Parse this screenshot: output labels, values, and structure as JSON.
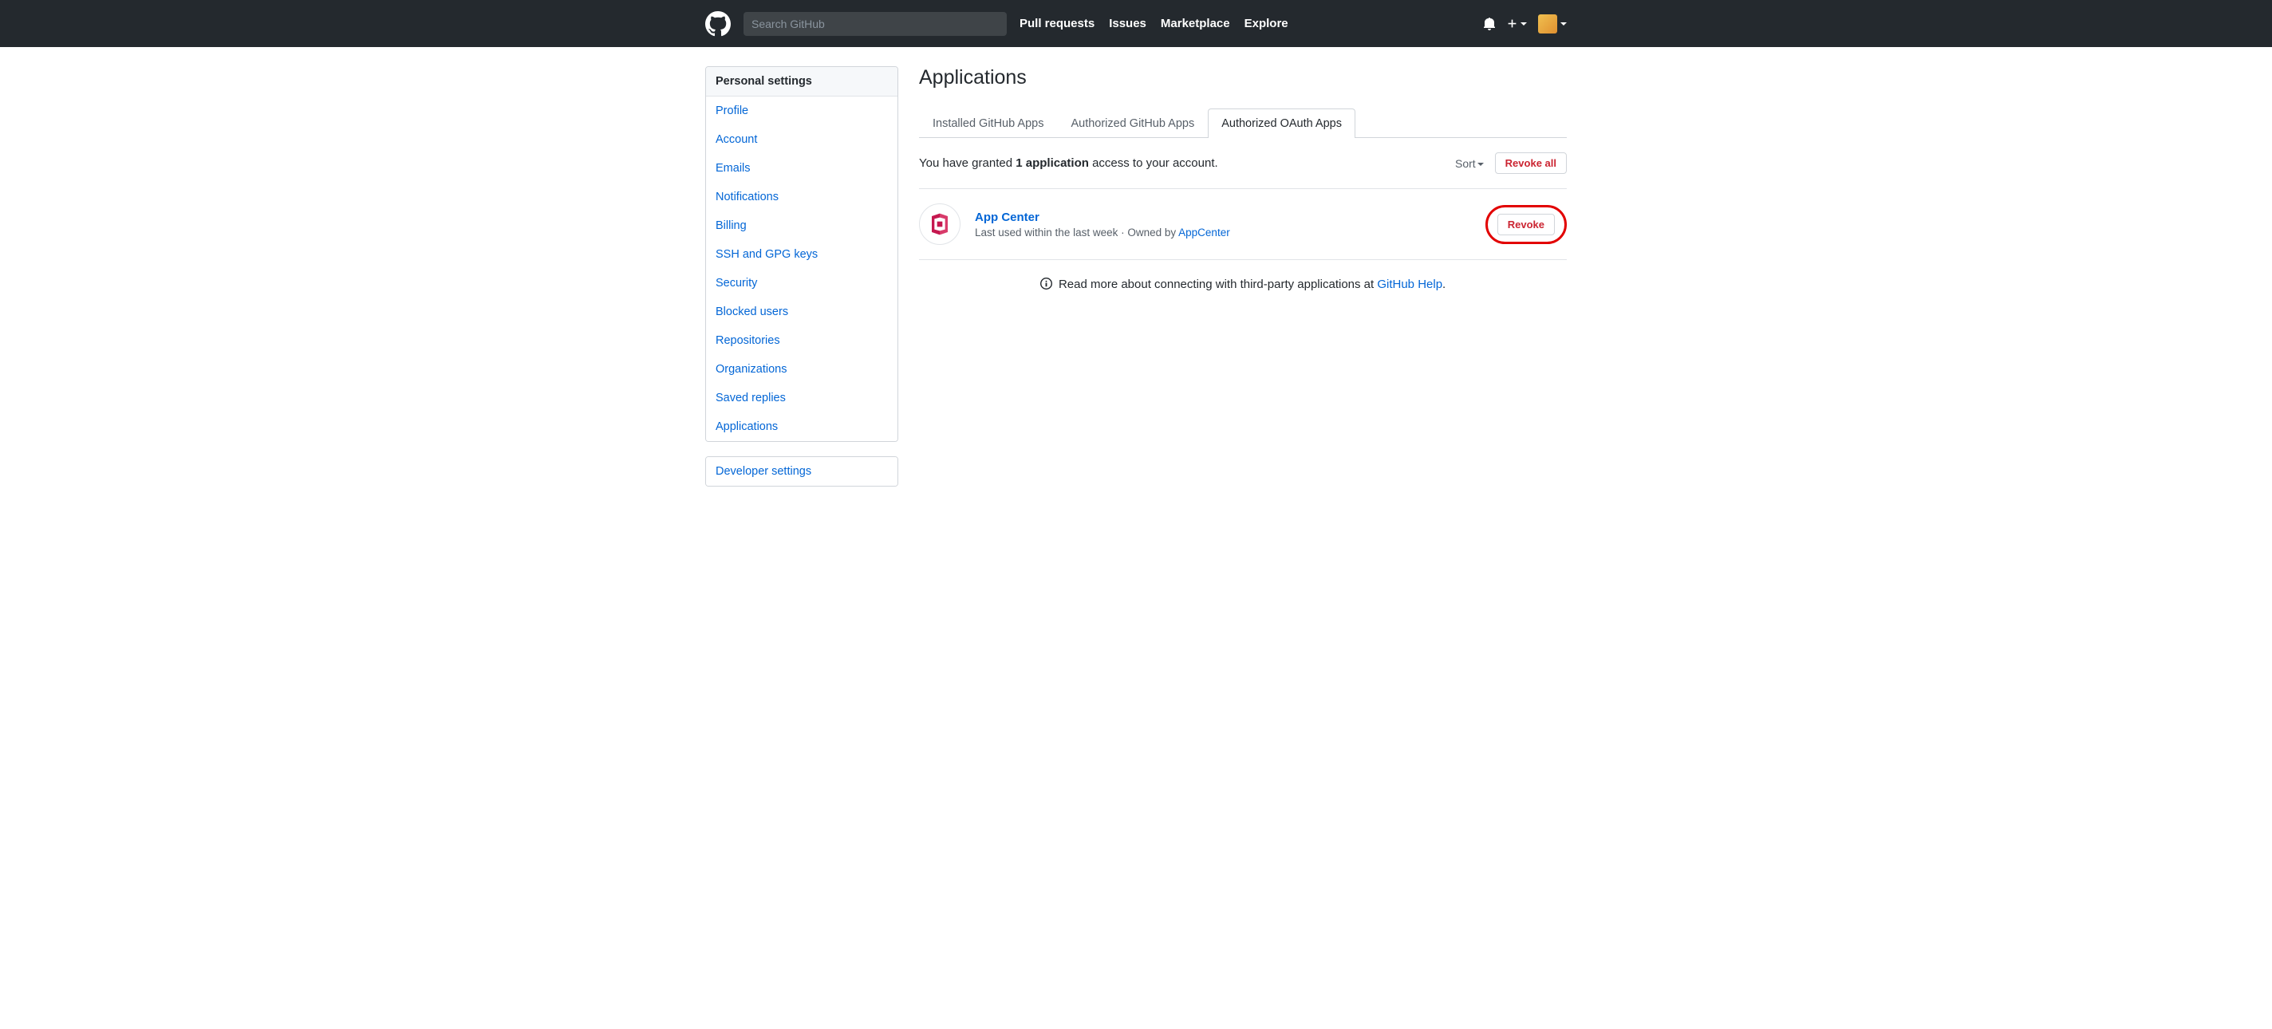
{
  "header": {
    "search_placeholder": "Search GitHub",
    "nav": {
      "pull_requests": "Pull requests",
      "issues": "Issues",
      "marketplace": "Marketplace",
      "explore": "Explore"
    }
  },
  "sidebar": {
    "personal_settings_heading": "Personal settings",
    "items": {
      "profile": "Profile",
      "account": "Account",
      "emails": "Emails",
      "notifications": "Notifications",
      "billing": "Billing",
      "ssh": "SSH and GPG keys",
      "security": "Security",
      "blocked": "Blocked users",
      "repositories": "Repositories",
      "organizations": "Organizations",
      "saved_replies": "Saved replies",
      "applications": "Applications"
    },
    "developer_settings": "Developer settings"
  },
  "main": {
    "title": "Applications",
    "tabs": {
      "installed": "Installed GitHub Apps",
      "authorized_apps": "Authorized GitHub Apps",
      "authorized_oauth": "Authorized OAuth Apps"
    },
    "grant": {
      "prefix": "You have granted ",
      "count": "1",
      "appword": " application",
      "suffix": " access to your account."
    },
    "sort_label": "Sort",
    "revoke_all_label": "Revoke all",
    "app": {
      "name": "App Center",
      "last_used": "Last used within the last week",
      "owned_by_prefix": " · Owned by ",
      "owner": "AppCenter",
      "revoke_label": "Revoke"
    },
    "help": {
      "text": "Read more about connecting with third-party applications at ",
      "link": "GitHub Help",
      "period": "."
    }
  }
}
